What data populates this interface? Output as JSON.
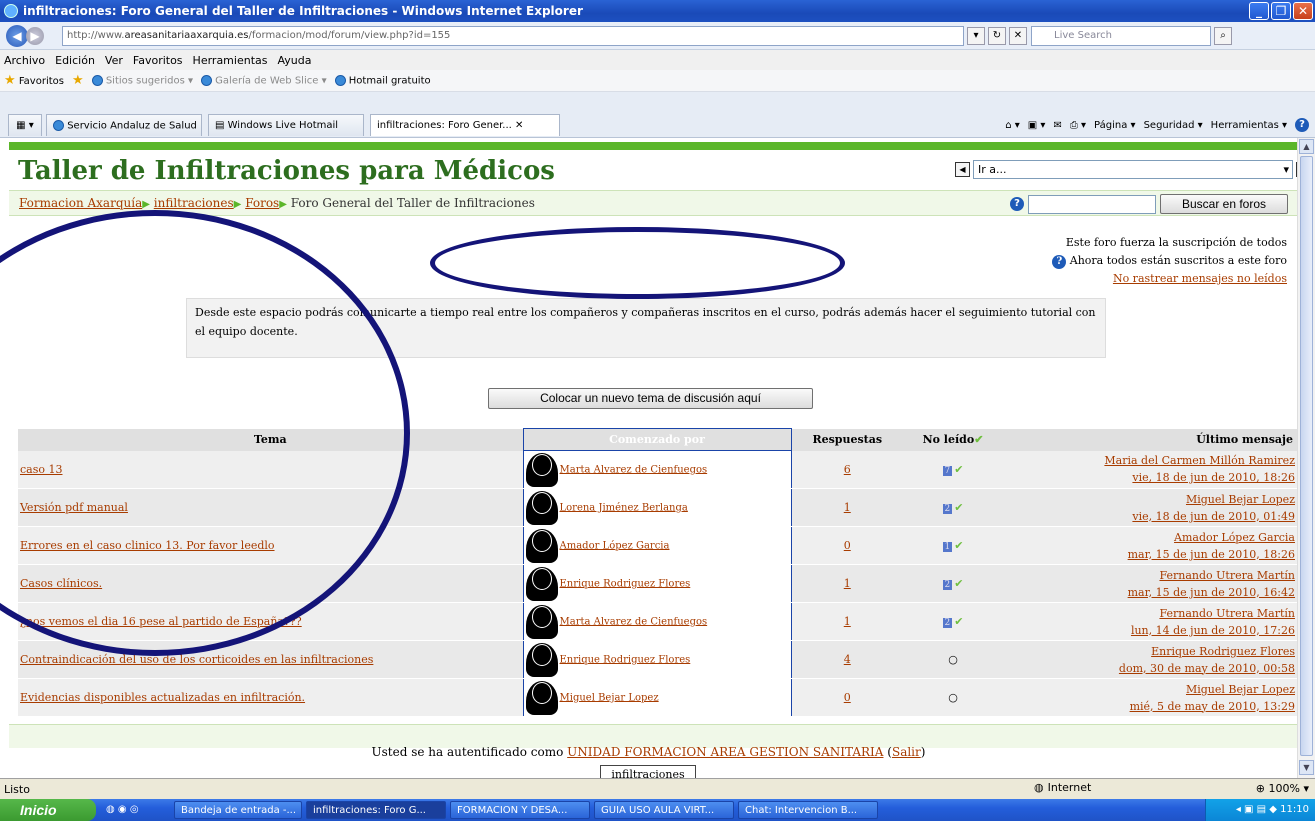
{
  "window": {
    "title": "infiltraciones: Foro General del Taller de Infiltraciones - Windows Internet Explorer"
  },
  "address": {
    "url_prefix": "http://www.",
    "url_domain": "areasanitariaaxarquia.es",
    "url_path": "/formacion/mod/forum/view.php?id=155",
    "search_placeholder": "Live Search"
  },
  "menu": [
    "Archivo",
    "Edición",
    "Ver",
    "Favoritos",
    "Herramientas",
    "Ayuda"
  ],
  "favorites": {
    "label": "Favoritos",
    "items": [
      "Sitios sugeridos",
      "Galería de Web Slice",
      "Hotmail gratuito"
    ]
  },
  "tabs": [
    "Servicio Andaluz de Salud",
    "Windows Live Hotmail",
    "infiltraciones: Foro Gener..."
  ],
  "commandbar": [
    "Página",
    "Seguridad",
    "Herramientas"
  ],
  "page": {
    "course_title": "Taller de Infiltraciones para Médicos",
    "jump_label": "Ir a...",
    "breadcrumb": [
      "Formacion Axarquía",
      "infiltraciones",
      "Foros",
      "Foro General del Taller de Infiltraciones"
    ],
    "search_button": "Buscar en foros",
    "subscription": [
      "Este foro fuerza la suscripción de todos",
      "Ahora todos están suscritos a este foro",
      "No rastrear mensajes no leídos"
    ],
    "intro": "Desde este espacio podrás comunicarte a tiempo real entre los compañeros y compañeras inscritos en el curso, podrás además hacer el seguimiento tutorial con el equipo docente.",
    "new_topic_button": "Colocar un nuevo tema de discusión aquí",
    "table_headers": [
      "Tema",
      "Comenzado por",
      "Respuestas",
      "No leído",
      "Último mensaje"
    ],
    "topics": [
      {
        "topic": "caso 13",
        "author": "Marta Alvarez de Cienfuegos",
        "replies": "6",
        "unread": "7",
        "last_user": "Maria del Carmen Millón Ramirez",
        "last_date": "vie, 18 de jun de 2010, 18:26"
      },
      {
        "topic": "Versión pdf manual",
        "author": "Lorena Jiménez Berlanga",
        "replies": "1",
        "unread": "2",
        "last_user": "Miguel Bejar Lopez",
        "last_date": "vie, 18 de jun de 2010, 01:49"
      },
      {
        "topic": "Errores en el caso clinico 13. Por favor leedlo",
        "author": "Amador López Garcia",
        "replies": "0",
        "unread": "1",
        "last_user": "Amador López Garcia",
        "last_date": "mar, 15 de jun de 2010, 18:26"
      },
      {
        "topic": "Casos clínicos.",
        "author": "Enrique Rodriguez Flores",
        "replies": "1",
        "unread": "2",
        "last_user": "Fernando Utrera Martín",
        "last_date": "mar, 15 de jun de 2010, 16:42"
      },
      {
        "topic": "¿nos vemos el dia 16 pese al partido de España???",
        "author": "Marta Alvarez de Cienfuegos",
        "replies": "1",
        "unread": "2",
        "last_user": "Fernando Utrera Martín",
        "last_date": "lun, 14 de jun de 2010, 17:26"
      },
      {
        "topic": "Contraindicación del uso de los corticoides en las infiltraciones",
        "author": "Enrique Rodriguez Flores",
        "replies": "4",
        "unread": "0",
        "last_user": "Enrique Rodriguez Flores",
        "last_date": "dom, 30 de may de 2010, 00:58"
      },
      {
        "topic": "Evidencias disponibles actualizadas en infiltración.",
        "author": "Miguel Bejar Lopez",
        "replies": "0",
        "unread": "0",
        "last_user": "Miguel Bejar Lopez",
        "last_date": "mié, 5 de may de 2010, 13:29"
      }
    ],
    "logged_prefix": "Usted se ha autentificado como",
    "logged_user": "UNIDAD FORMACION AREA GESTION SANITARIA",
    "logout": "Salir",
    "home_button": "infiltraciones"
  },
  "status": {
    "left": "Listo",
    "zone": "Internet",
    "zoom": "100%"
  },
  "taskbar": {
    "start": "Inicio",
    "items": [
      "Bandeja de entrada -...",
      "infiltraciones: Foro G...",
      "FORMACION Y DESA...",
      "GUIA USO AULA VIRT...",
      "Chat: Intervencion B..."
    ],
    "clock": "11:10"
  },
  "colors": {
    "title_green": "#2d6e1f",
    "link": "#a83c00",
    "bar_green": "#5bb62a",
    "annotation_oval": "#141478"
  }
}
